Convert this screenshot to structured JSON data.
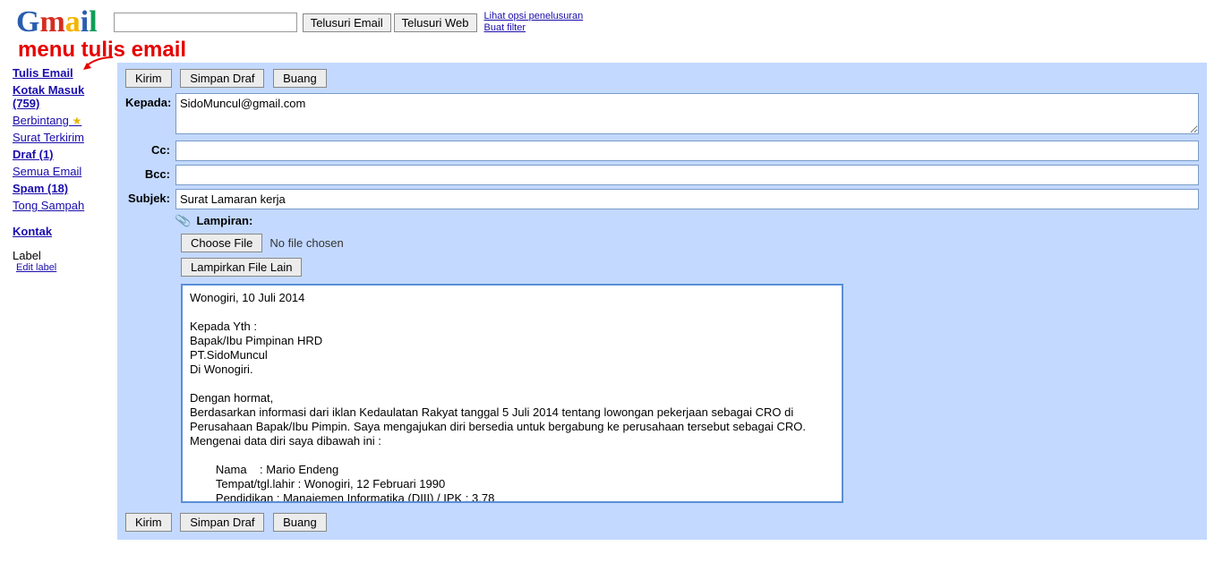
{
  "header": {
    "logo_text": "Gmail",
    "search_email_btn": "Telusuri Email",
    "search_web_btn": "Telusuri Web",
    "link_search_options": "Lihat opsi penelusuran",
    "link_create_filter": "Buat filter"
  },
  "annotation": {
    "text": "menu tulis email"
  },
  "sidebar": {
    "compose": "Tulis Email",
    "inbox": "Kotak Masuk (759)",
    "starred": "Berbintang",
    "sent": "Surat Terkirim",
    "drafts": "Draf (1)",
    "all_mail": "Semua Email",
    "spam": "Spam (18)",
    "trash": "Tong Sampah",
    "contacts": "Kontak",
    "label_heading": "Label",
    "edit_label": "Edit label"
  },
  "toolbar": {
    "send": "Kirim",
    "save_draft": "Simpan Draf",
    "discard": "Buang"
  },
  "form": {
    "to_label": "Kepada:",
    "to_value": "SidoMuncul@gmail.com",
    "cc_label": "Cc:",
    "cc_value": "",
    "bcc_label": "Bcc:",
    "bcc_value": "",
    "subject_label": "Subjek:",
    "subject_value": "Surat Lamaran kerja",
    "attach_label": "Lampiran:",
    "choose_file": "Choose File",
    "no_file": "No file chosen",
    "attach_more": "Lampirkan File Lain"
  },
  "body_text": "Wonogiri, 10 Juli 2014\n\nKepada Yth :\nBapak/Ibu Pimpinan HRD\nPT.SidoMuncul\nDi Wonogiri.\n\nDengan hormat,\nBerdasarkan informasi dari iklan Kedaulatan Rakyat tanggal 5 Juli 2014 tentang lowongan pekerjaan sebagai CRO di Perusahaan Bapak/Ibu Pimpin. Saya mengajukan diri bersedia untuk bergabung ke perusahaan tersebut sebagai CRO. Mengenai data diri saya dibawah ini :\n\n        Nama    : Mario Endeng\n        Tempat/tgl.lahir : Wonogiri, 12 Februari 1990\n        Pendidikan : Manajemen Informatika (DIII) / IPK : 3.78"
}
